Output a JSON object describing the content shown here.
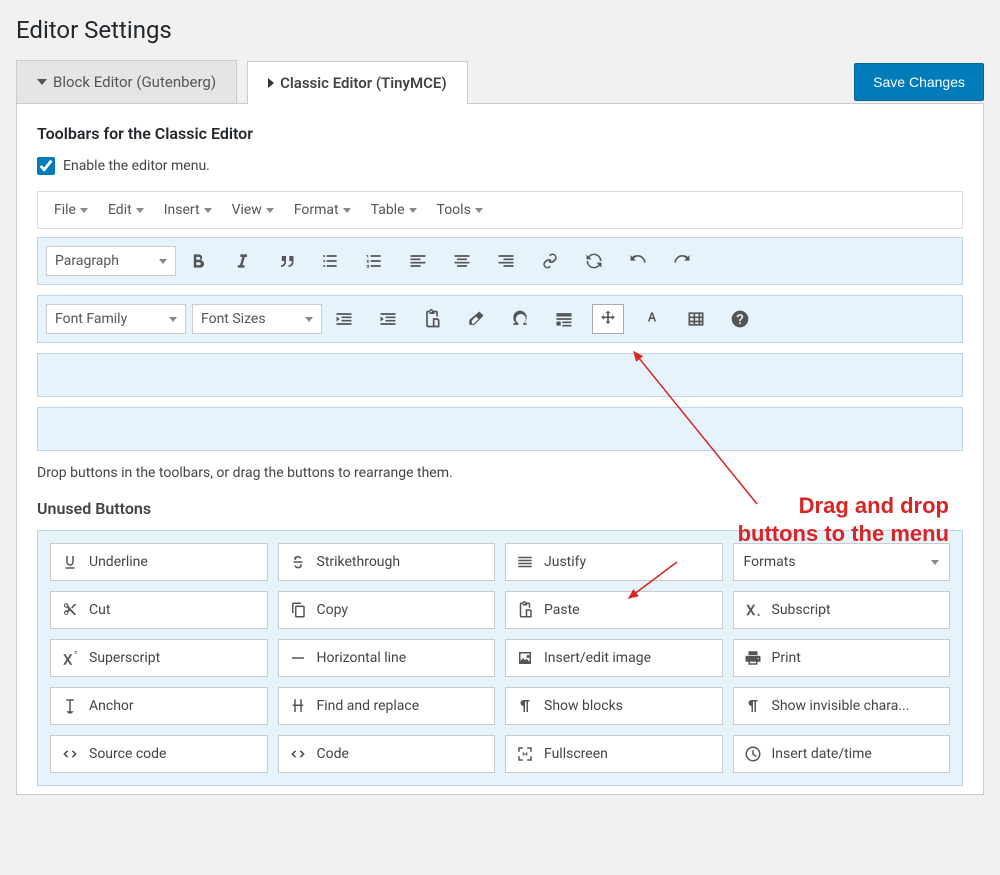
{
  "page_title": "Editor Settings",
  "tabs": {
    "block": "Block Editor (Gutenberg)",
    "classic": "Classic Editor (TinyMCE)"
  },
  "save_button": "Save Changes",
  "toolbars_heading": "Toolbars for the Classic Editor",
  "enable_menu_label": "Enable the editor menu.",
  "enable_menu_checked": true,
  "menu_items": [
    "File",
    "Edit",
    "Insert",
    "View",
    "Format",
    "Table",
    "Tools"
  ],
  "toolbar1": {
    "paragraph": "Paragraph",
    "buttons": [
      "bold",
      "italic",
      "blockquote",
      "ul",
      "ol",
      "align-left",
      "align-center",
      "align-right",
      "link",
      "retry",
      "undo",
      "redo"
    ]
  },
  "toolbar2": {
    "font_family": "Font Family",
    "font_sizes": "Font Sizes",
    "buttons": [
      "outdent",
      "indent",
      "paste",
      "eraser",
      "omega",
      "hr",
      "move",
      "textcolor",
      "table",
      "help"
    ]
  },
  "drop_hint": "Drop buttons in the toolbars, or drag the buttons to rearrange them.",
  "unused_heading": "Unused Buttons",
  "unused": [
    {
      "icon": "underline",
      "label": "Underline"
    },
    {
      "icon": "strike",
      "label": "Strikethrough"
    },
    {
      "icon": "justify",
      "label": "Justify"
    },
    {
      "icon": "formats",
      "label": "Formats",
      "dropdown": true
    },
    {
      "icon": "cut",
      "label": "Cut"
    },
    {
      "icon": "copy",
      "label": "Copy"
    },
    {
      "icon": "paste",
      "label": "Paste"
    },
    {
      "icon": "subscript",
      "label": "Subscript"
    },
    {
      "icon": "superscript",
      "label": "Superscript"
    },
    {
      "icon": "hline",
      "label": "Horizontal line"
    },
    {
      "icon": "image",
      "label": "Insert/edit image"
    },
    {
      "icon": "print",
      "label": "Print"
    },
    {
      "icon": "anchor",
      "label": "Anchor"
    },
    {
      "icon": "find",
      "label": "Find and replace"
    },
    {
      "icon": "pilcrow",
      "label": "Show blocks"
    },
    {
      "icon": "invisible",
      "label": "Show invisible chara..."
    },
    {
      "icon": "code",
      "label": "Source code"
    },
    {
      "icon": "code",
      "label": "Code"
    },
    {
      "icon": "fullscreen",
      "label": "Fullscreen"
    },
    {
      "icon": "clock",
      "label": "Insert date/time"
    }
  ],
  "annotation": {
    "line1": "Drag and drop",
    "line2": "buttons to the menu"
  }
}
